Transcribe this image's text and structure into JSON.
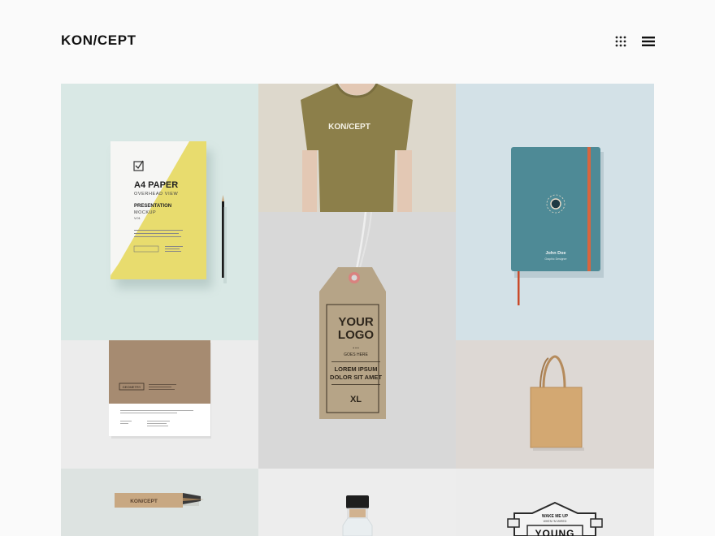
{
  "site": {
    "logo": "KON/CEPT",
    "icons": {
      "grid": "grid-dots-icon",
      "menu": "hamburger-menu-icon"
    }
  },
  "colors": {
    "background": "#fafafa",
    "logo_text": "#111111"
  },
  "portfolio": {
    "a4": {
      "title": "A4 PAPER",
      "subtitle": "OVERHEAD VIEW",
      "line1": "PRESENTATION",
      "line2": "MOCKUP",
      "version": "V.01"
    },
    "tshirt": {
      "print": "KON/CEPT"
    },
    "notebook": {
      "name": "John Doe",
      "role": "Graphic Designer"
    },
    "tag": {
      "line1": "YOUR",
      "line2": "LOGO",
      "line3": "GOES HERE",
      "line4": "LOREM IPSUM",
      "line5": "DOLOR SIT AMET",
      "size": "XL"
    },
    "folder": {
      "brand": "GEOMETRY"
    },
    "pencil_box": {
      "brand": "KON/CEPT"
    },
    "badge": {
      "line1": "WAKE ME UP",
      "line2": "WHEN I'M WIRED",
      "line3": "YOUNG"
    }
  }
}
